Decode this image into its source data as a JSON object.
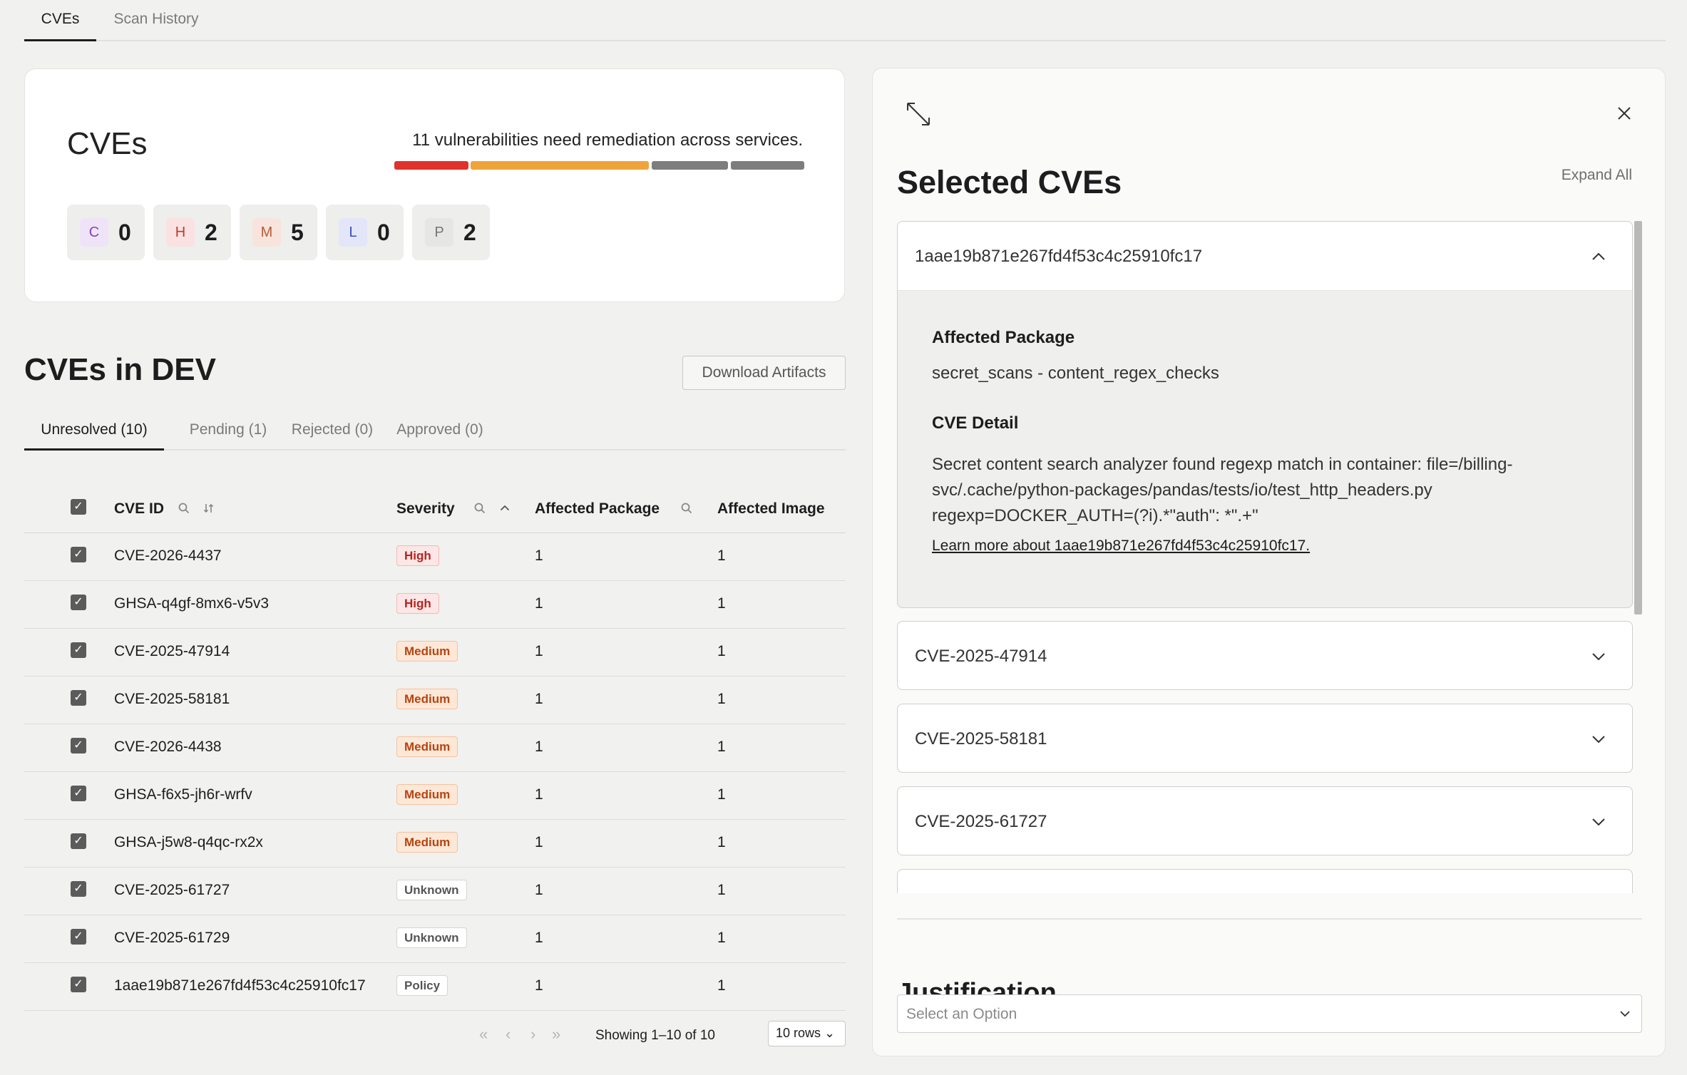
{
  "topnav": {
    "tabs": [
      {
        "label": "CVEs",
        "active": true
      },
      {
        "label": "Scan History",
        "active": false
      }
    ]
  },
  "summary": {
    "title": "CVEs",
    "remediation_text": "11 vulnerabilities need remediation across services.",
    "severity_bar_colors": [
      "#e0322c",
      "#efa43a",
      "#7d7d7d",
      "#7d7d7d"
    ],
    "chips": [
      {
        "letter": "C",
        "count": "0",
        "bg": "#efe4f7",
        "fg": "#8a3fbf"
      },
      {
        "letter": "H",
        "count": "2",
        "bg": "#fbe2e2",
        "fg": "#c0392b"
      },
      {
        "letter": "M",
        "count": "5",
        "bg": "#f8e4dc",
        "fg": "#b85a35"
      },
      {
        "letter": "L",
        "count": "0",
        "bg": "#e3e6f8",
        "fg": "#3b4fbf"
      },
      {
        "letter": "P",
        "count": "2",
        "bg": "#e6e6e4",
        "fg": "#777777"
      }
    ]
  },
  "dev": {
    "title": "CVEs in DEV",
    "download_label": "Download Artifacts",
    "tabs": [
      {
        "label": "Unresolved (10)",
        "active": true
      },
      {
        "label": "Pending (1)",
        "active": false
      },
      {
        "label": "Rejected (0)",
        "active": false
      },
      {
        "label": "Approved (0)",
        "active": false
      }
    ]
  },
  "table": {
    "headers": {
      "cve_id": "CVE ID",
      "severity": "Severity",
      "package": "Affected Package",
      "image": "Affected Image"
    },
    "rows": [
      {
        "id": "CVE-2026-4437",
        "severity": "High",
        "package": "1",
        "image": "1"
      },
      {
        "id": "GHSA-q4gf-8mx6-v5v3",
        "severity": "High",
        "package": "1",
        "image": "1"
      },
      {
        "id": "CVE-2025-47914",
        "severity": "Medium",
        "package": "1",
        "image": "1"
      },
      {
        "id": "CVE-2025-58181",
        "severity": "Medium",
        "package": "1",
        "image": "1"
      },
      {
        "id": "CVE-2026-4438",
        "severity": "Medium",
        "package": "1",
        "image": "1"
      },
      {
        "id": "GHSA-f6x5-jh6r-wrfv",
        "severity": "Medium",
        "package": "1",
        "image": "1"
      },
      {
        "id": "GHSA-j5w8-q4qc-rx2x",
        "severity": "Medium",
        "package": "1",
        "image": "1"
      },
      {
        "id": "CVE-2025-61727",
        "severity": "Unknown",
        "package": "1",
        "image": "1"
      },
      {
        "id": "CVE-2025-61729",
        "severity": "Unknown",
        "package": "1",
        "image": "1"
      },
      {
        "id": "1aae19b871e267fd4f53c4c25910fc17",
        "severity": "Policy",
        "package": "1",
        "image": "1"
      }
    ]
  },
  "pager": {
    "showing": "Showing 1–10 of 10",
    "rows_label": "10 rows"
  },
  "panel": {
    "title": "Selected CVEs",
    "expand_all": "Expand All",
    "expanded": {
      "id": "1aae19b871e267fd4f53c4c25910fc17",
      "package_label": "Affected Package",
      "package_value": "secret_scans - content_regex_checks",
      "detail_label": "CVE Detail",
      "detail_text": "Secret content search analyzer found regexp match in container: file=/billing-svc/.cache/python-packages/pandas/tests/io/test_http_headers.py regexp=DOCKER_AUTH=(?i).*\"auth\": *\".+\"",
      "learn_more": "Learn more about 1aae19b871e267fd4f53c4c25910fc17."
    },
    "collapsed": [
      "CVE-2025-47914",
      "CVE-2025-58181",
      "CVE-2025-61727"
    ],
    "justification_title": "Justification",
    "select_placeholder": "Select an Option"
  }
}
